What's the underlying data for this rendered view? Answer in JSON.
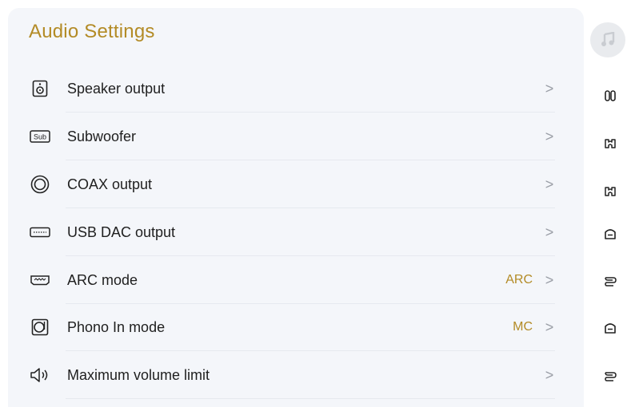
{
  "page": {
    "title": "Audio Settings"
  },
  "settings": [
    {
      "label": "Speaker output",
      "value": "",
      "icon": "speaker-icon"
    },
    {
      "label": "Subwoofer",
      "value": "",
      "icon": "sub-icon"
    },
    {
      "label": "COAX output",
      "value": "",
      "icon": "coax-icon"
    },
    {
      "label": "USB DAC output",
      "value": "",
      "icon": "usb-dac-icon"
    },
    {
      "label": "ARC mode",
      "value": "ARC",
      "icon": "arc-icon"
    },
    {
      "label": "Phono In mode",
      "value": "MC",
      "icon": "phono-icon"
    },
    {
      "label": "Maximum volume limit",
      "value": "",
      "icon": "volume-icon"
    }
  ],
  "chevron": ">",
  "sidebar": {
    "top_icon": "music-note-icon",
    "icons": [
      "pause-icon",
      "headphone-icon",
      "headphone-icon",
      "home-icon",
      "loop-icon",
      "home-icon",
      "loop-icon"
    ]
  },
  "colors": {
    "accent": "#b38b26",
    "panel_bg": "#f4f6fa",
    "text": "#1f1f1f",
    "chevron": "#9a9ea6"
  }
}
